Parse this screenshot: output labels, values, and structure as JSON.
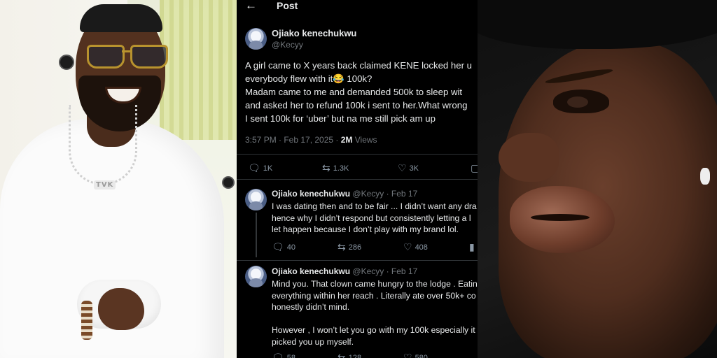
{
  "tweet_panel": {
    "topbar": {
      "back_icon": "back-arrow-icon",
      "title": "Post"
    },
    "main_post": {
      "author_name": "Ojiako kenechukwu",
      "author_handle": "@Kecyy",
      "text_lines": [
        "A girl came to X years back claimed KENE locked her u",
        "everybody flew with it😂 100k?",
        "Madam came to me and demanded 500k to sleep wit",
        "and asked her to refund 100k i sent to her.What wrong",
        "I sent 100k for ‘uber’ but na me still pick am up"
      ],
      "timestamp": "3:57 PM · Feb 17, 2025 · ",
      "views_count": "2M",
      "views_label": " Views",
      "actions": {
        "replies": "1K",
        "reposts": "1.3K",
        "likes": "3K"
      }
    },
    "replies": [
      {
        "author_name": "Ojiako kenechukwu",
        "meta": " @Kecyy · Feb 17",
        "text_lines": [
          "I was dating then and to be fair ... I didn’t want any dra",
          "hence why I didn’t respond but consistently letting a l",
          "let happen because I don’t play with my brand lol."
        ],
        "actions": {
          "replies": "40",
          "reposts": "286",
          "likes": "408"
        }
      },
      {
        "author_name": "Ojiako kenechukwu",
        "meta": " @Kecyy · Feb 17",
        "text_lines": [
          "Mind you. That clown came hungry to the lodge . Eatin",
          "everything within her reach . Literally ate over 50k+ co",
          "honestly didn’t mind.",
          "",
          "However , I won’t let you go with my 100k especially it",
          "picked you up myself."
        ],
        "actions": {
          "replies": "58",
          "reposts": "128",
          "likes": "580"
        }
      }
    ],
    "icons": {
      "reply": "reply-icon",
      "repost": "repost-icon",
      "like": "heart-icon",
      "views": "views-icon",
      "bookmark": "bookmark-icon"
    }
  },
  "left_photo": {
    "pendant_text": "TVK"
  },
  "colors": {
    "background": "#000000",
    "text_primary": "#e7e9ea",
    "text_secondary": "#71767b",
    "divider": "#2f3336"
  }
}
